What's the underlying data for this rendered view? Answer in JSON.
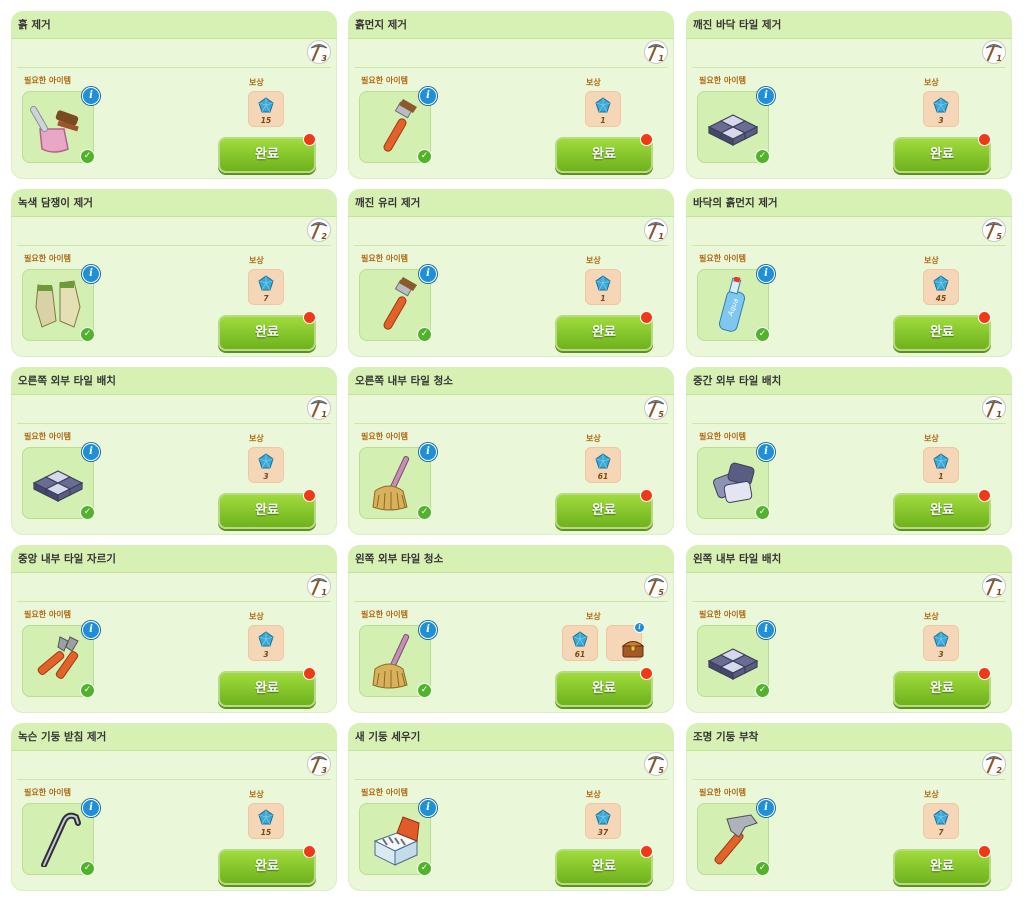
{
  "labels": {
    "required_items": "필요한 아이템",
    "reward": "보상",
    "complete": "완료"
  },
  "colors": {
    "card_bg": "#eaf7d8",
    "header_bg": "#d7f0b3",
    "button_green": "#7cc223",
    "alert_red": "#f03a17",
    "gem_blue": "#3aa9d6"
  },
  "tasks": [
    {
      "title": "흙 제거",
      "count": "3",
      "item_icon": "dustpan-brush-icon",
      "rewards": [
        {
          "icon": "gem-icon",
          "value": "15"
        }
      ]
    },
    {
      "title": "흙먼지 제거",
      "count": "1",
      "item_icon": "paintbrush-icon",
      "rewards": [
        {
          "icon": "gem-icon",
          "value": "1"
        }
      ]
    },
    {
      "title": "깨진 바닥 타일 제거",
      "count": "1",
      "item_icon": "floor-tiles-icon",
      "rewards": [
        {
          "icon": "gem-icon",
          "value": "3"
        }
      ]
    },
    {
      "title": "녹색 담쟁이 제거",
      "count": "2",
      "item_icon": "gloves-icon",
      "rewards": [
        {
          "icon": "gem-icon",
          "value": "7"
        }
      ]
    },
    {
      "title": "깨진 유리 제거",
      "count": "1",
      "item_icon": "paintbrush-icon",
      "rewards": [
        {
          "icon": "gem-icon",
          "value": "1"
        }
      ]
    },
    {
      "title": "바닥의 흙먼지 제거",
      "count": "5",
      "item_icon": "cleaner-bottle-icon",
      "rewards": [
        {
          "icon": "gem-icon",
          "value": "45"
        }
      ]
    },
    {
      "title": "오른쪽 외부 타일 배치",
      "count": "1",
      "item_icon": "floor-tiles-icon",
      "rewards": [
        {
          "icon": "gem-icon",
          "value": "3"
        }
      ]
    },
    {
      "title": "오른쪽 내부 타일 청소",
      "count": "5",
      "item_icon": "mop-icon",
      "rewards": [
        {
          "icon": "gem-icon",
          "value": "61"
        }
      ]
    },
    {
      "title": "중간 외부 타일 배치",
      "count": "1",
      "item_icon": "stone-tiles-icon",
      "rewards": [
        {
          "icon": "gem-icon",
          "value": "1"
        }
      ]
    },
    {
      "title": "중앙 내부 타일 자르기",
      "count": "1",
      "item_icon": "tile-cutter-icon",
      "rewards": [
        {
          "icon": "gem-icon",
          "value": "3"
        }
      ]
    },
    {
      "title": "왼쪽 외부 타일 청소",
      "count": "5",
      "item_icon": "mop-icon",
      "rewards": [
        {
          "icon": "gem-icon",
          "value": "61"
        },
        {
          "icon": "treasure-chest-icon",
          "value": ""
        }
      ]
    },
    {
      "title": "왼쪽 내부 타일 배치",
      "count": "1",
      "item_icon": "floor-tiles-icon",
      "rewards": [
        {
          "icon": "gem-icon",
          "value": "3"
        }
      ]
    },
    {
      "title": "녹슨 기둥 받침 제거",
      "count": "3",
      "item_icon": "crowbar-icon",
      "rewards": [
        {
          "icon": "gem-icon",
          "value": "15"
        }
      ]
    },
    {
      "title": "새 기둥 세우기",
      "count": "5",
      "item_icon": "nails-box-icon",
      "rewards": [
        {
          "icon": "gem-icon",
          "value": "37"
        }
      ]
    },
    {
      "title": "조명 기둥 부착",
      "count": "2",
      "item_icon": "hammer-icon",
      "rewards": [
        {
          "icon": "gem-icon",
          "value": "7"
        }
      ]
    }
  ]
}
